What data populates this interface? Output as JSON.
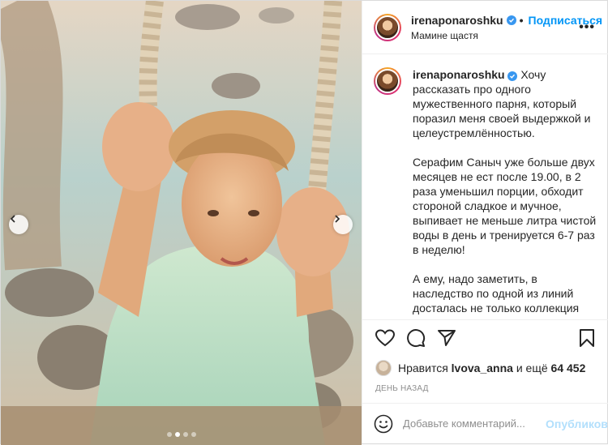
{
  "post": {
    "username": "irenaponaroshku",
    "subscribe_label": "Подписаться",
    "separator": "•",
    "location": "Мамине щастя",
    "more_label": "•••"
  },
  "caption": {
    "username": "irenaponaroshku",
    "paragraph1": "Хочу рассказать про одного мужественного парня, который поразил меня своей выдержкой и целеустремлённостью.",
    "paragraph2": "Серафим Саныч уже больше двух месяцев не ест после 19.00, в 2 раза уменьшил порции, обходит стороной сладкое и мучное, выпивает не меньше литра чистой воды в день и тренируется 6-7 раз в неделю!",
    "paragraph3": "А ему, надо заметить, в наследство по одной из линий досталась не только коллекция виниловых пластинок, но и неуёмный аппетит вкупе с достаточно флегматичным метаболизмом."
  },
  "likes": {
    "prefix": "Нравится",
    "user": "lvova_anna",
    "middle": "и ещё",
    "count": "64 452"
  },
  "date": "ДЕНЬ НАЗАД",
  "comment": {
    "placeholder": "Добавьте комментарий...",
    "publish_label": "Опубликовать"
  },
  "carousel": {
    "total": 4,
    "active_index": 1
  },
  "icons": {
    "heart": "heart-icon",
    "comment": "comment-icon",
    "share": "share-icon",
    "bookmark": "bookmark-icon",
    "emoji": "emoji-icon",
    "verified": "verified-badge-icon"
  },
  "colors": {
    "accent": "#0095f6",
    "verified": "#3897f0",
    "muted": "#8e8e8e",
    "publish_disabled": "#b2dffc"
  }
}
